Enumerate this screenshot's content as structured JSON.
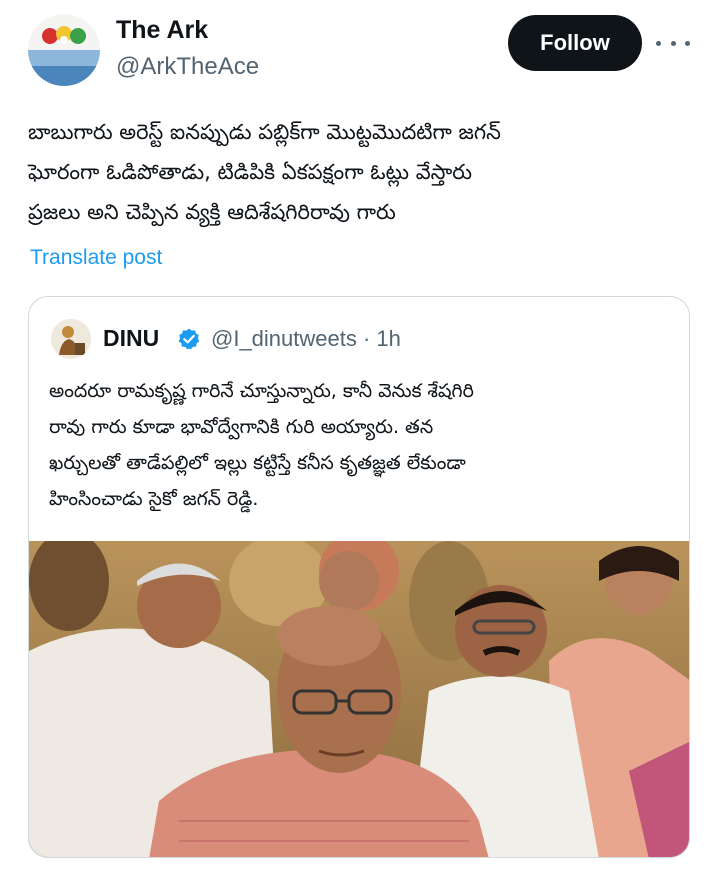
{
  "author": {
    "name": "The Ark",
    "handle": "@ArkTheAce"
  },
  "follow_label": "Follow",
  "post": {
    "lines": [
      "బాబుగారు అరెస్ట్ ఐనప్పుడు పబ్లిక్‌గా మొట్టమొదటిగా జగన్",
      "ఘోరంగా ఓడిపోతాడు, టిడిపికి ఏకపక్షంగా ఓట్లు వేస్తారు",
      "ప్రజలు అని చెప్పిన వ్యక్తి ఆదిశేషగిరిరావు గారు"
    ],
    "translate_label": "Translate post"
  },
  "quote": {
    "name": "DINU",
    "handle_time": "@I_dinutweets · 1h",
    "lines": [
      "అందరూ రామకృష్ణ గారినే చూస్తున్నారు, కానీ వెనుక శేషగిరి",
      "రావు గారు కూడా భావోద్వేగానికి గురి అయ్యారు. తన",
      "ఖర్చులతో తాడేపల్లిలో ఇల్లు కట్టిస్తే కనీస కృతజ్ఞత లేకుండా",
      "హింసించాడు సైకో జగన్ రెడ్డి."
    ]
  },
  "colors": {
    "text": "#0f1419",
    "secondary": "#536471",
    "link": "#1d9bf0",
    "border": "#cfd9de",
    "follow_bg": "#0f1419"
  },
  "icons": [
    "more-horizontal-icon",
    "verified-badge-icon"
  ]
}
